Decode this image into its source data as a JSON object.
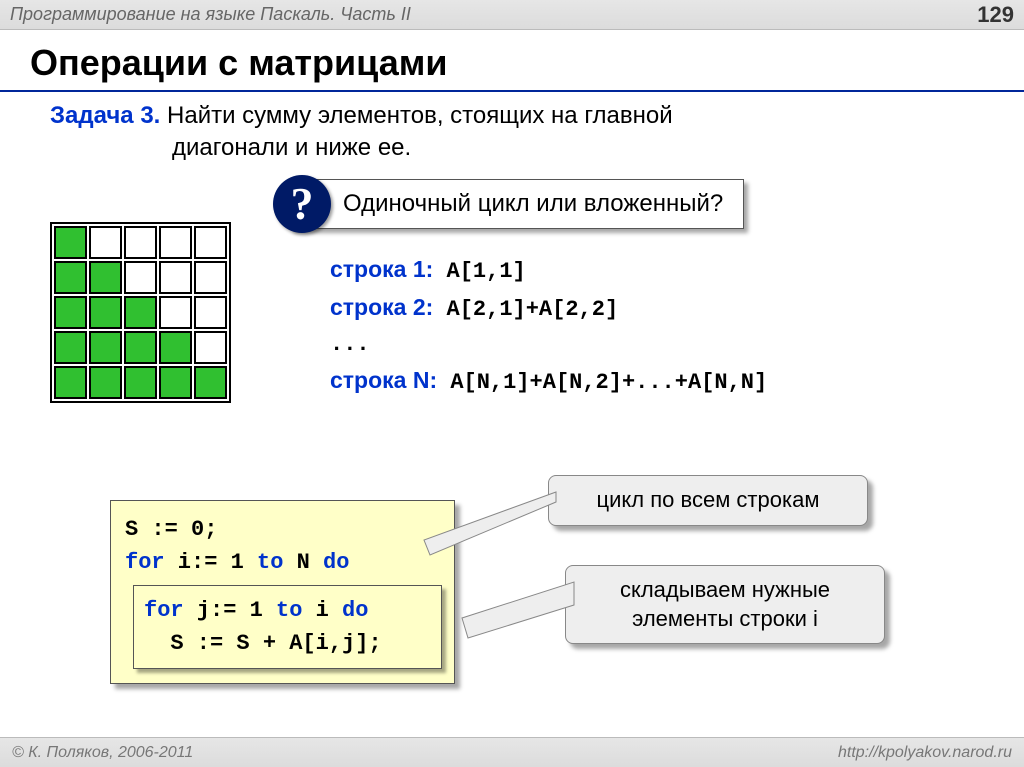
{
  "header": {
    "course": "Программирование на языке Паскаль. Часть II",
    "page": "129"
  },
  "title": "Операции с матрицами",
  "task": {
    "label": "Задача 3.",
    "text_l1": " Найти сумму элементов, стоящих  на главной",
    "text_l2": "диагонали и ниже ее."
  },
  "question": "Одиночный цикл или вложенный?",
  "rows": {
    "r1_label": "строка 1:",
    "r1_code": " A[1,1]",
    "r2_label": "строка 2:",
    "r2_code": " A[2,1]+A[2,2]",
    "dots": "...",
    "rn_label": "строка N:",
    "rn_code": " A[N,1]+A[N,2]+...+A[N,N]"
  },
  "code": {
    "l1a": "S := 0;",
    "l2a": "for",
    "l2b": " i:= 1 ",
    "l2c": "to",
    "l2d": " N ",
    "l2e": "do",
    "l3a": "for",
    "l3b": " j:= 1 ",
    "l3c": "to",
    "l3d": " i ",
    "l3e": "do",
    "l4a": "  S := S + A[i,j];"
  },
  "callouts": {
    "c1": "цикл по всем строкам",
    "c2_l1": "складываем нужные",
    "c2_l2": "элементы строки i"
  },
  "footer": {
    "copyright": "© К. Поляков, 2006-2011",
    "url": "http://kpolyakov.narod.ru"
  }
}
